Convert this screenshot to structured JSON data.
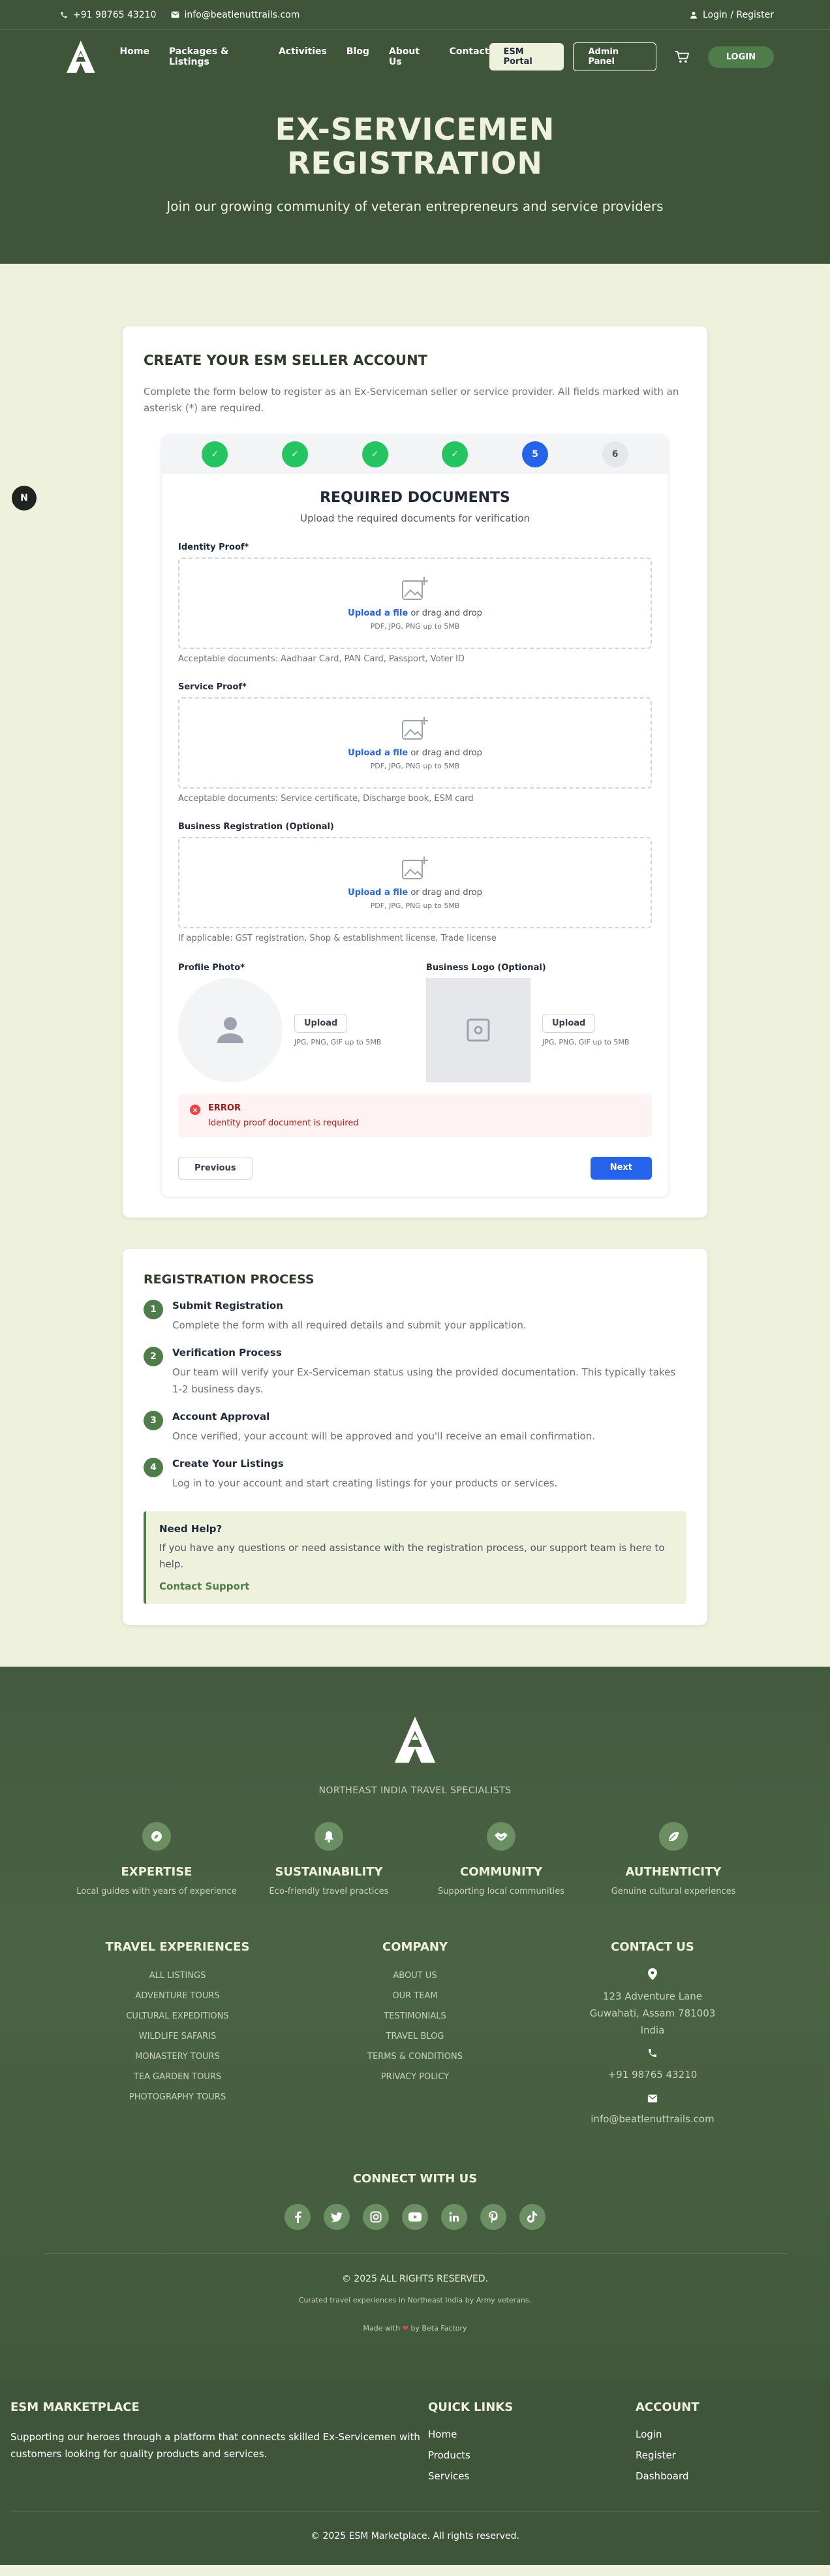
{
  "topbar": {
    "phone": "+91 98765 43210",
    "email": "info@beatlenuttrails.com",
    "login": "Login / Register"
  },
  "nav": {
    "links": [
      "Home",
      "Packages & Listings",
      "Activities",
      "Blog",
      "About Us",
      "Contact"
    ],
    "esm_portal": "ESM Portal",
    "admin_panel": "Admin Panel",
    "login": "LOGIN"
  },
  "hero": {
    "title_line1": "EX-SERVICEMEN",
    "title_line2": "REGISTRATION",
    "subtitle": "Join our growing community of veteran entrepreneurs and service providers"
  },
  "badge": "N",
  "form_card": {
    "title": "CREATE YOUR ESM SELLER ACCOUNT",
    "intro": "Complete the form below to register as an Ex-Serviceman seller or service provider. All fields marked with an asterisk (*) are required.",
    "steps": [
      {
        "label": "✓",
        "state": "done"
      },
      {
        "label": "✓",
        "state": "done"
      },
      {
        "label": "✓",
        "state": "done"
      },
      {
        "label": "✓",
        "state": "done"
      },
      {
        "label": "5",
        "state": "active"
      },
      {
        "label": "6",
        "state": "todo"
      }
    ],
    "section_title": "REQUIRED DOCUMENTS",
    "section_subtitle": "Upload the required documents for verification",
    "upload_link": "Upload a file",
    "drag_text": " or drag and drop",
    "file_hint": "PDF, JPG, PNG up to 5MB",
    "identity": {
      "label": "Identity Proof*",
      "help": "Acceptable documents: Aadhaar Card, PAN Card, Passport, Voter ID"
    },
    "service": {
      "label": "Service Proof*",
      "help": "Acceptable documents: Service certificate, Discharge book, ESM card"
    },
    "business": {
      "label": "Business Registration (Optional)",
      "help": "If applicable: GST registration, Shop & establishment license, Trade license"
    },
    "profile_photo": {
      "label": "Profile Photo*",
      "button": "Upload",
      "hint": "JPG, PNG, GIF up to 5MB"
    },
    "business_logo": {
      "label": "Business Logo (Optional)",
      "button": "Upload",
      "hint": "JPG, PNG, GIF up to 5MB"
    },
    "error": {
      "title": "ERROR",
      "message": "Identity proof document is required"
    },
    "previous": "Previous",
    "next": "Next"
  },
  "process": {
    "title": "REGISTRATION PROCESS",
    "steps": [
      {
        "num": "1",
        "title": "Submit Registration",
        "desc": "Complete the form with all required details and submit your application."
      },
      {
        "num": "2",
        "title": "Verification Process",
        "desc": "Our team will verify your Ex-Serviceman status using the provided documentation. This typically takes 1-2 business days."
      },
      {
        "num": "3",
        "title": "Account Approval",
        "desc": "Once verified, your account will be approved and you'll receive an email confirmation."
      },
      {
        "num": "4",
        "title": "Create Your Listings",
        "desc": "Log in to your account and start creating listings for your products or services."
      }
    ],
    "help_title": "Need Help?",
    "help_text": "If you have any questions or need assistance with the registration process, our support team is here to help.",
    "help_link": "Contact Support"
  },
  "footer": {
    "tagline": "NORTHEAST INDIA TRAVEL SPECIALISTS",
    "features": [
      {
        "icon": "compass-icon",
        "title": "EXPERTISE",
        "desc": "Local guides with years of experience"
      },
      {
        "icon": "bell-icon",
        "title": "SUSTAINABILITY",
        "desc": "Eco-friendly travel practices"
      },
      {
        "icon": "handshake-icon",
        "title": "COMMUNITY",
        "desc": "Supporting local communities"
      },
      {
        "icon": "leaf-icon",
        "title": "AUTHENTICITY",
        "desc": "Genuine cultural experiences"
      }
    ],
    "travel_title": "TRAVEL EXPERIENCES",
    "travel_links": [
      "ALL LISTINGS",
      "ADVENTURE TOURS",
      "CULTURAL EXPEDITIONS",
      "WILDLIFE SAFARIS",
      "MONASTERY TOURS",
      "TEA GARDEN TOURS",
      "PHOTOGRAPHY TOURS"
    ],
    "company_title": "COMPANY",
    "company_links": [
      "ABOUT US",
      "OUR TEAM",
      "TESTIMONIALS",
      "TRAVEL BLOG",
      "TERMS & CONDITIONS",
      "PRIVACY POLICY"
    ],
    "contact_title": "CONTACT US",
    "address_line1": "123 Adventure Lane",
    "address_line2": "Guwahati, Assam 781003",
    "address_line3": "India",
    "phone": "+91 98765 43210",
    "email": "info@beatlenuttrails.com",
    "connect_title": "CONNECT WITH US",
    "socials": [
      "f",
      "t",
      "ig",
      "yt",
      "in",
      "p",
      "tk"
    ],
    "copyright": "© 2025 ALL RIGHTS RESERVED.",
    "curated": "Curated travel experiences in Northeast India by Army veterans.",
    "made_with_prefix": "Made with",
    "made_with_suffix": "by Beta Factory"
  },
  "footer2": {
    "brand": "ESM MARKETPLACE",
    "desc": "Supporting our heroes through a platform that connects skilled Ex-Servicemen with customers looking for quality products and services.",
    "quick_title": "QUICK LINKS",
    "quick_links": [
      "Home",
      "Products",
      "Services"
    ],
    "account_title": "ACCOUNT",
    "account_links": [
      "Login",
      "Register",
      "Dashboard"
    ],
    "copyright": "© 2025 ESM Marketplace. All rights reserved."
  },
  "colors": {
    "brand_dark": "#3e5539",
    "brand_green": "#4f7d4a",
    "cream": "#eef2dc",
    "primary_blue": "#2563eb",
    "success": "#22c55e",
    "error": "#ef4444"
  }
}
